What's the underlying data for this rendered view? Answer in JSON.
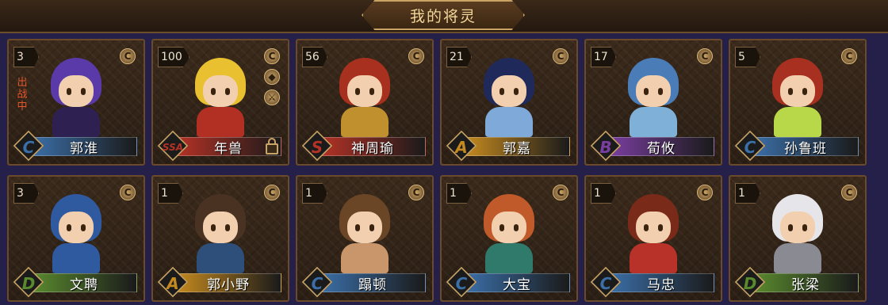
{
  "header": {
    "title": "我的将灵"
  },
  "colors": {
    "C": "#3b6fa8",
    "A": "#c58a1f",
    "S": "#b53226",
    "SSA": "#b53226",
    "B": "#7a3ea0",
    "D": "#5a8a2e"
  },
  "cards": [
    {
      "level": "3",
      "name": "郭淮",
      "rank": "C",
      "status": "出战中",
      "hair": "#5a3aa8",
      "body": "#2e2050"
    },
    {
      "level": "100",
      "name": "年兽",
      "rank": "SSA",
      "hair": "#e8c030",
      "body": "#b22f24",
      "locked": true
    },
    {
      "level": "56",
      "name": "神周瑜",
      "rank": "S",
      "hair": "#a8301e",
      "body": "#c0902e"
    },
    {
      "level": "21",
      "name": "郭嘉",
      "rank": "A",
      "hair": "#1f2a5a",
      "body": "#7fa9d8"
    },
    {
      "level": "17",
      "name": "荀攸",
      "rank": "B",
      "hair": "#4a7db8",
      "body": "#7fb0d8"
    },
    {
      "level": "5",
      "name": "孙鲁班",
      "rank": "C",
      "hair": "#a83020",
      "body": "#b8d84a"
    },
    {
      "level": "3",
      "name": "文聘",
      "rank": "D",
      "hair": "#2f5aa0",
      "body": "#2f5aa0"
    },
    {
      "level": "1",
      "name": "郭小野",
      "rank": "A",
      "hair": "#4a3222",
      "body": "#2e4f7a"
    },
    {
      "level": "1",
      "name": "蹋顿",
      "rank": "C",
      "hair": "#6a4526",
      "body": "#c8966a"
    },
    {
      "level": "1",
      "name": "大宝",
      "rank": "C",
      "hair": "#c05a2a",
      "body": "#2f7a6a"
    },
    {
      "level": "1",
      "name": "马忠",
      "rank": "C",
      "hair": "#7a2a18",
      "body": "#b8322a"
    },
    {
      "level": "1",
      "name": "张梁",
      "rank": "D",
      "hair": "#e6e6ea",
      "body": "#8a8a92"
    }
  ],
  "icons": {
    "corner": "coin-icon",
    "lock": "lock-icon"
  }
}
